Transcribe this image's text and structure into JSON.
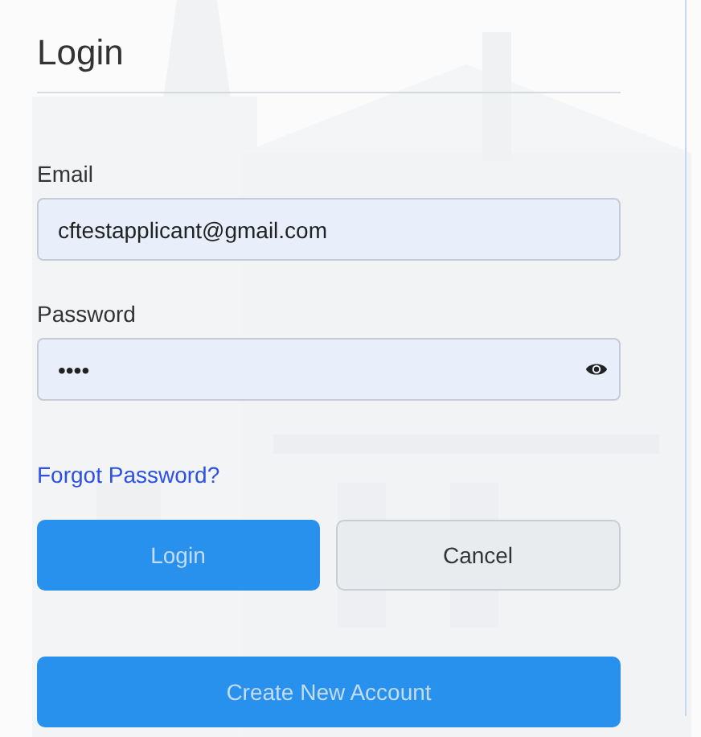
{
  "title": "Login",
  "fields": [
    {
      "label": "Email",
      "value": "cftestapplicant@gmail.com",
      "kind": "text"
    },
    {
      "label": "Password",
      "value": "••••",
      "kind": "password"
    }
  ],
  "forgot_link": "Forgot Password?",
  "buttons": [
    {
      "label": "Login",
      "kind": "primary"
    },
    {
      "label": "Cancel",
      "kind": "secondary"
    }
  ],
  "create_button": {
    "label": "Create New Account"
  }
}
